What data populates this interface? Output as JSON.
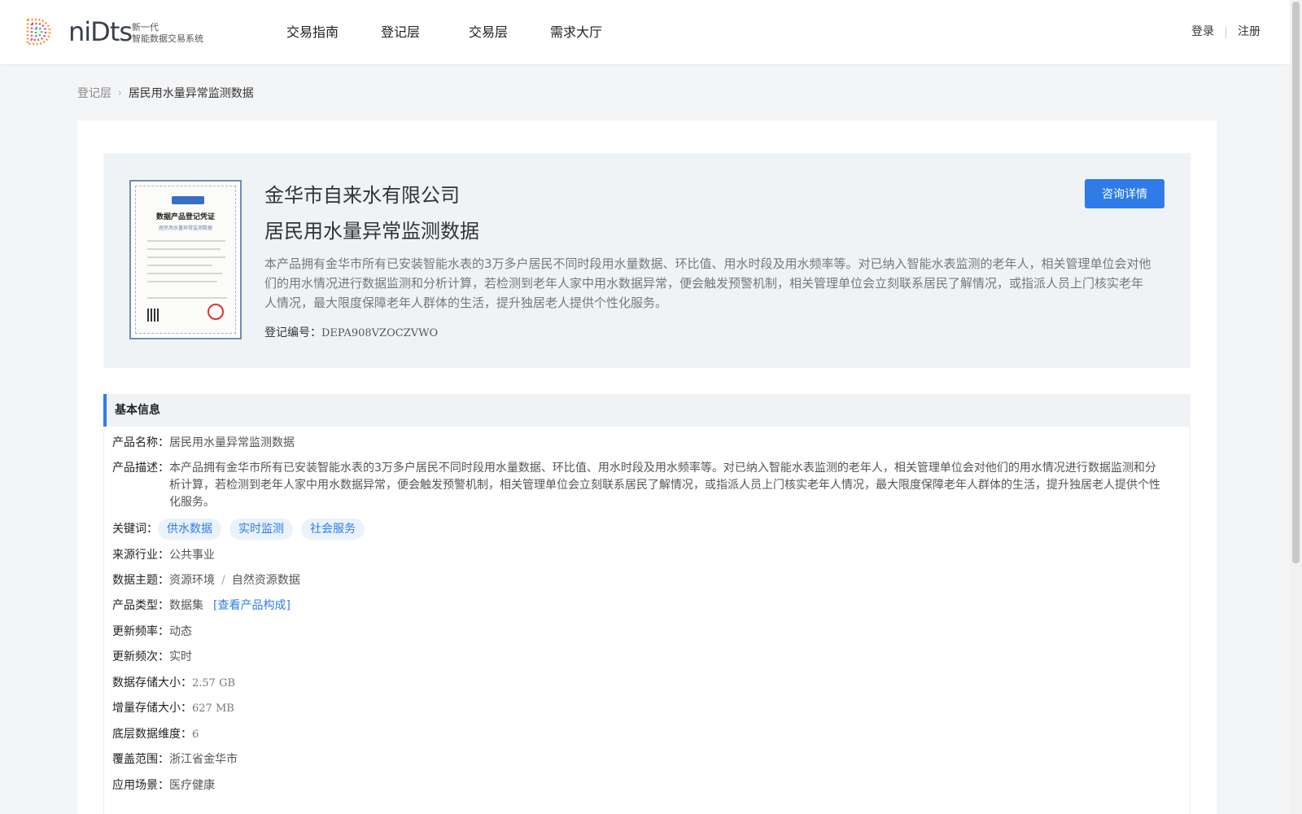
{
  "header": {
    "logo": {
      "word": "niDts",
      "line1": "新一代",
      "line2": "智能数据交易系统"
    },
    "nav": [
      "交易指南",
      "登记层",
      "交易层",
      "需求大厅"
    ],
    "login": "登录",
    "register": "注册"
  },
  "breadcrumb": {
    "parent": "登记层",
    "current": "居民用水量异常监测数据"
  },
  "hero": {
    "certificate_title": "数据产品登记凭证",
    "certificate_sub": "居民用水量异常监测数据",
    "company": "金华市自来水有限公司",
    "title": "居民用水量异常监测数据",
    "description": "本产品拥有金华市所有已安装智能水表的3万多户居民不同时段用水量数据、环比值、用水时段及用水频率等。对已纳入智能水表监测的老年人，相关管理单位会对他们的用水情况进行数据监测和分析计算，若检测到老年人家中用水数据异常，便会触发预警机制，相关管理单位会立刻联系居民了解情况，或指派人员上门核实老年人情况，最大限度保障老年人群体的生活，提升独居老人提供个性化服务。",
    "reg_label": "登记编号：",
    "reg_code": "DEPA908VZOCZVWO",
    "consult_button": "咨询详情"
  },
  "basic_info": {
    "heading": "基本信息",
    "product_name": {
      "label": "产品名称：",
      "value": "居民用水量异常监测数据"
    },
    "product_desc": {
      "label": "产品描述：",
      "value": "本产品拥有金华市所有已安装智能水表的3万多户居民不同时段用水量数据、环比值、用水时段及用水频率等。对已纳入智能水表监测的老年人，相关管理单位会对他们的用水情况进行数据监测和分析计算，若检测到老年人家中用水数据异常，便会触发预警机制，相关管理单位会立刻联系居民了解情况，或指派人员上门核实老年人情况，最大限度保障老年人群体的生活，提升独居老人提供个性化服务。"
    },
    "keywords": {
      "label": "关键词：",
      "tags": [
        "供水数据",
        "实时监测",
        "社会服务"
      ]
    },
    "industry": {
      "label": "来源行业：",
      "value": "公共事业"
    },
    "theme": {
      "label": "数据主题：",
      "value1": "资源环境",
      "separator": "/",
      "value2": "自然资源数据"
    },
    "product_type": {
      "label": "产品类型：",
      "value": "数据集",
      "link": "[查看产品构成]"
    },
    "update_rate": {
      "label": "更新频率：",
      "value": "动态"
    },
    "update_freq": {
      "label": "更新频次：",
      "value": "实时"
    },
    "storage": {
      "label": "数据存储大小：",
      "value": "2.57 GB"
    },
    "incr_storage": {
      "label": "增量存储大小：",
      "value": "627 MB"
    },
    "dimension": {
      "label": "底层数据维度：",
      "value": "6"
    },
    "coverage": {
      "label": "覆盖范围：",
      "value": "浙江省金华市"
    },
    "scenario": {
      "label": "应用场景：",
      "value": "医疗健康"
    }
  }
}
